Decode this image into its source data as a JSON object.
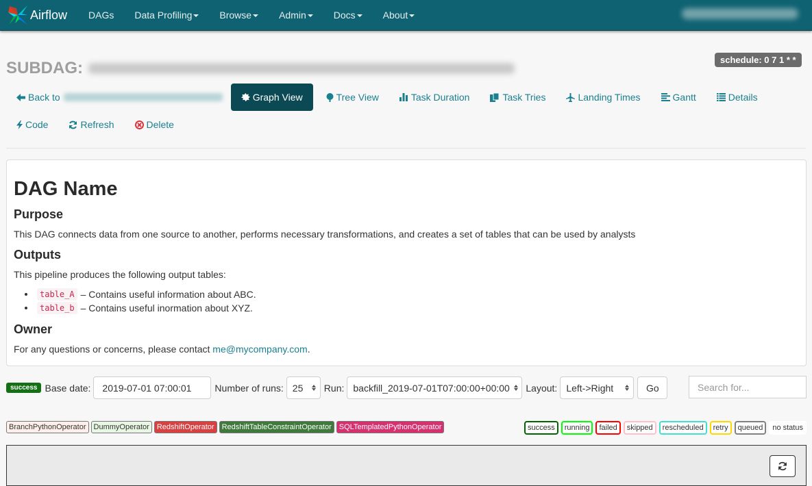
{
  "navbar": {
    "brand": "Airflow",
    "items": [
      {
        "label": "DAGs",
        "dropdown": false
      },
      {
        "label": "Data Profiling",
        "dropdown": true
      },
      {
        "label": "Browse",
        "dropdown": true
      },
      {
        "label": "Admin",
        "dropdown": true
      },
      {
        "label": "Docs",
        "dropdown": true
      },
      {
        "label": "About",
        "dropdown": true
      }
    ]
  },
  "header": {
    "subdag_label": "SUBDAG:",
    "schedule": "schedule: 0 7 1 * *"
  },
  "views": {
    "back_label": "Back to",
    "graph_view": "Graph View",
    "tree_view": "Tree View",
    "task_duration": "Task Duration",
    "task_tries": "Task Tries",
    "landing_times": "Landing Times",
    "gantt": "Gantt",
    "details": "Details",
    "code": "Code",
    "refresh": "Refresh",
    "delete": "Delete"
  },
  "doc": {
    "title": "DAG Name",
    "purpose_heading": "Purpose",
    "purpose_text": "This DAG connects data from one source to another, performs necessary transformations, and creates a set of tables that can be used by analysts",
    "outputs_heading": "Outputs",
    "outputs_intro": "This pipeline produces the following output tables:",
    "outputs": [
      {
        "table": "table_A",
        "desc": "– Contains useful information about ABC."
      },
      {
        "table": "table_b",
        "desc": "– Contains useful inormation about XYZ."
      }
    ],
    "owner_heading": "Owner",
    "owner_text": "For any questions or concerns, please contact ",
    "owner_email": "me@mycompany.com",
    "owner_suffix": "."
  },
  "controls": {
    "state": "success",
    "base_date_label": "Base date:",
    "base_date_value": "2019-07-01 07:00:01",
    "num_runs_label": "Number of runs:",
    "num_runs_value": "25",
    "run_label": "Run:",
    "run_value": "backfill_2019-07-01T07:00:00+00:00",
    "layout_label": "Layout:",
    "layout_value": "Left->Right",
    "go_label": "Go",
    "search_placeholder": "Search for..."
  },
  "operators": [
    {
      "name": "BranchPythonOperator",
      "bg": "#ffefeb",
      "fg": "#333333"
    },
    {
      "name": "DummyOperator",
      "bg": "#e8f7e4",
      "fg": "#333333"
    },
    {
      "name": "RedshiftOperator",
      "bg": "#d84141",
      "fg": "#ffffff"
    },
    {
      "name": "RedshiftTableConstraintOperator",
      "bg": "#3f7a3c",
      "fg": "#ffffff"
    },
    {
      "name": "SQLTemplatedPythonOperator",
      "bg": "#d6306f",
      "fg": "#ffffff"
    }
  ],
  "states": [
    {
      "name": "success",
      "color": "#006400"
    },
    {
      "name": "running",
      "color": "#00ff00"
    },
    {
      "name": "failed",
      "color": "#ff0000"
    },
    {
      "name": "skipped",
      "color": "#ffc0cb"
    },
    {
      "name": "rescheduled",
      "color": "#40e0d0"
    },
    {
      "name": "retry",
      "color": "#ffd700"
    },
    {
      "name": "queued",
      "color": "#808080"
    },
    {
      "name": "no status",
      "color": "#ffffff"
    }
  ]
}
